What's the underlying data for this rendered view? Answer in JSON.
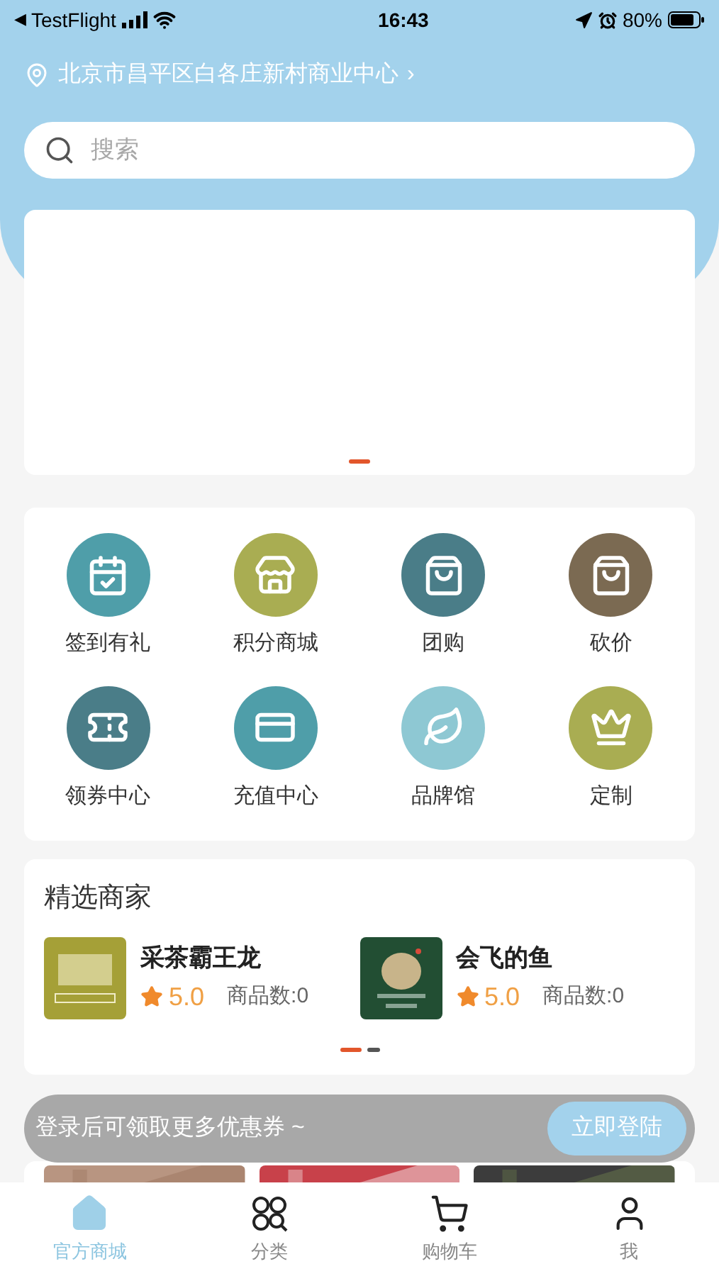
{
  "status_bar": {
    "back": "◀",
    "carrier": "TestFlight",
    "time": "16:43",
    "battery": "80%"
  },
  "location": {
    "address": "北京市昌平区白各庄新村商业中心",
    "chevron": "›"
  },
  "search": {
    "placeholder": "搜索"
  },
  "banner": {
    "dots": [
      {
        "selected": true
      }
    ]
  },
  "shortcuts": [
    {
      "label": "签到有礼",
      "color": "#4f9ea9"
    },
    {
      "label": "积分商城",
      "color": "#a9ad52"
    },
    {
      "label": "团购",
      "color": "#4a7d88"
    },
    {
      "label": "砍价",
      "color": "#7b6a52"
    },
    {
      "label": "领券中心",
      "color": "#4a7d88"
    },
    {
      "label": "充值中心",
      "color": "#4f9ea9"
    },
    {
      "label": "品牌馆",
      "color": "#8ec8d3"
    },
    {
      "label": "定制",
      "color": "#a9ad52"
    }
  ],
  "merchants": {
    "title": "精选商家",
    "items": [
      {
        "name": "采茶霸王龙",
        "rating": "5.0",
        "count": "商品数:0"
      },
      {
        "name": "会飞的鱼",
        "rating": "5.0",
        "count": "商品数:0"
      }
    ],
    "dots": [
      {
        "selected": true
      },
      {
        "selected": false
      }
    ]
  },
  "toast": {
    "text": "登录后可领取更多优惠券 ~",
    "button": "立即登陆"
  },
  "tab_bar": [
    {
      "label": "官方商城",
      "selected": true
    },
    {
      "label": "分类",
      "selected": false
    },
    {
      "label": "购物车",
      "selected": false
    },
    {
      "label": "我",
      "selected": false
    }
  ]
}
